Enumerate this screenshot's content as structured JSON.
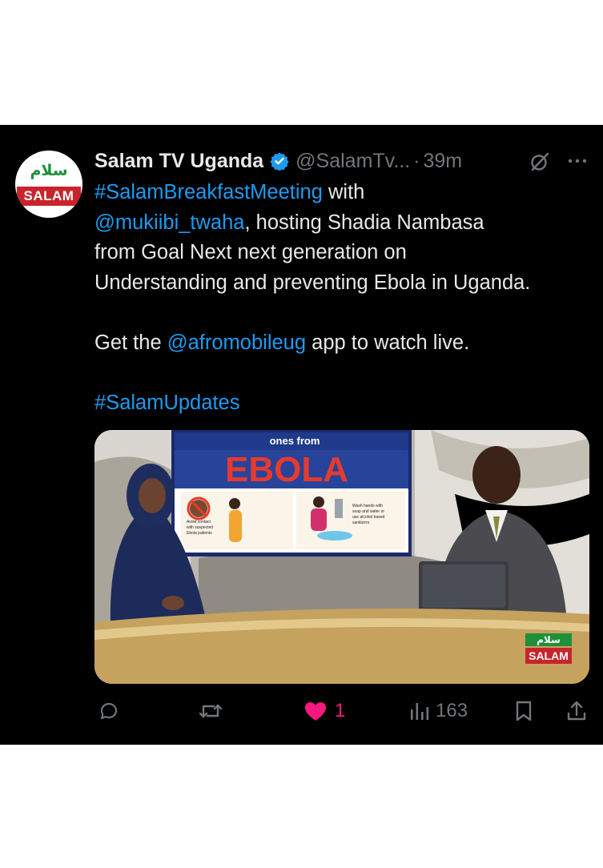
{
  "tweet": {
    "avatar": {
      "arabic_text": "سلام",
      "label": "SALAM"
    },
    "author": {
      "display_name": "Salam TV Uganda",
      "handle": "@SalamTv...",
      "separator": "·",
      "time": "39m"
    },
    "body": {
      "line1_hashtag": "#SalamBreakfastMeeting",
      "line1_rest": " with",
      "line2_mention": "@mukiibi_twaha",
      "line2_rest": ", hosting Shadia Nambasa",
      "line3": "from Goal Next next generation on",
      "line4": "Understanding and preventing Ebola in Uganda.",
      "line5_pre": "Get the ",
      "line5_mention": "@afromobileug",
      "line5_post": " app to watch live.",
      "line6_hashtag": "#SalamUpdates"
    },
    "media": {
      "screen_caption": "ones from",
      "screen_headline": "EBOLA",
      "panel_left_text": "Avoid contact with suspected Ebola patients",
      "panel_right_text": "Wash hands with soap and water or use alcohol based sanitizers",
      "watermark_arabic": "سلام",
      "watermark_label": "SALAM"
    },
    "actions": {
      "like_count": "1",
      "views_count": "163"
    }
  },
  "colors": {
    "background": "#000000",
    "text": "#e7e9ea",
    "muted": "#71767b",
    "link": "#1d9bf0",
    "verified": "#1d9bf0",
    "like": "#f91880"
  },
  "icons": [
    "verified-badge-icon",
    "grok-icon",
    "more-icon",
    "reply-icon",
    "retweet-icon",
    "heart-icon",
    "views-icon",
    "bookmark-icon",
    "share-icon"
  ]
}
